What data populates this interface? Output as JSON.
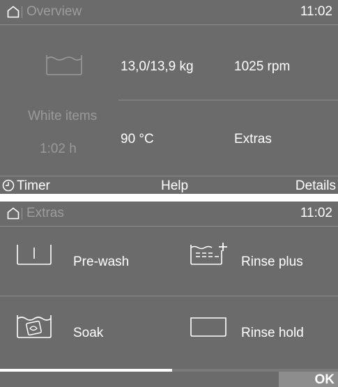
{
  "overview": {
    "title": "Overview",
    "time": "11:02",
    "program_name": "White items",
    "duration": "1:02  h",
    "load": "13,0/13,9 kg",
    "spin": "1025 rpm",
    "temperature": "90 °C",
    "extras_label": "Extras",
    "bottom": {
      "timer_label": "Timer",
      "help_label": "Help",
      "details_label": "Details"
    },
    "icons": [
      "home-icon",
      "tub-icon",
      "clock-icon"
    ]
  },
  "extras": {
    "title": "Extras",
    "time": "11:02",
    "options": [
      {
        "label": "Pre-wash",
        "icon": "prewash-icon"
      },
      {
        "label": "Rinse plus",
        "icon": "rinse-plus-icon"
      },
      {
        "label": "Soak",
        "icon": "soak-icon"
      },
      {
        "label": "Rinse hold",
        "icon": "rinse-hold-icon"
      }
    ],
    "progress": 0.51,
    "ok_label": "OK",
    "icons": [
      "home-icon"
    ]
  },
  "colors": {
    "screen_bg": "#6b6b6b",
    "dim_text": "#9a9a9a",
    "ok_bg": "#8d8d8d"
  }
}
